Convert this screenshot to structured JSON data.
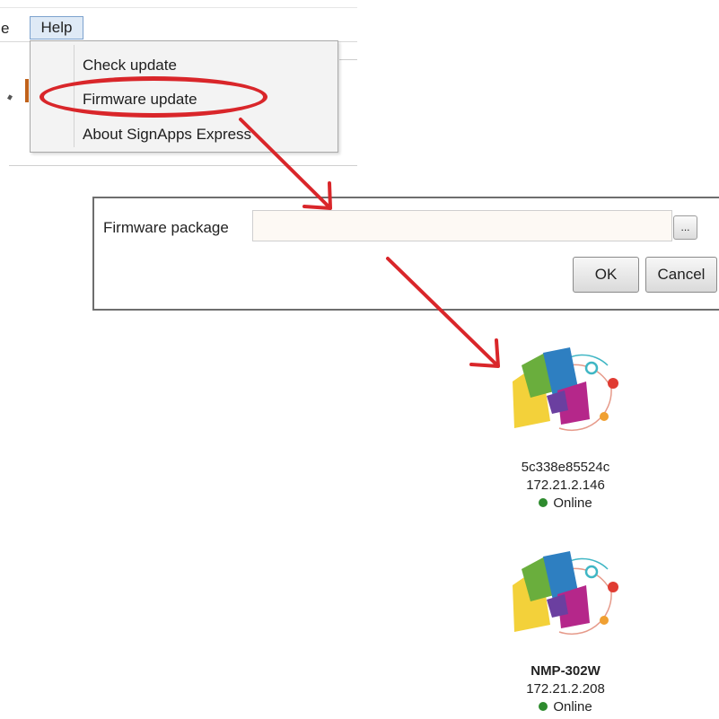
{
  "menubar": {
    "prev_menu_partial": "e",
    "help_label": "Help"
  },
  "help_menu": {
    "items": [
      {
        "label": "Check update"
      },
      {
        "label": "Firmware update"
      },
      {
        "label": "About SignApps Express"
      }
    ]
  },
  "firmware_dialog": {
    "package_label": "Firmware package",
    "package_value": "",
    "browse_label": "...",
    "ok_label": "OK",
    "cancel_label": "Cancel"
  },
  "devices": [
    {
      "name": "5c338e85524c",
      "ip": "172.21.2.146",
      "status": "Online",
      "status_color": "#2e8b2e"
    },
    {
      "name": "NMP-302W",
      "ip": "172.21.2.208",
      "status": "Online",
      "status_color": "#2e8b2e"
    }
  ],
  "annotation": {
    "highlight_color": "#d9262a"
  }
}
